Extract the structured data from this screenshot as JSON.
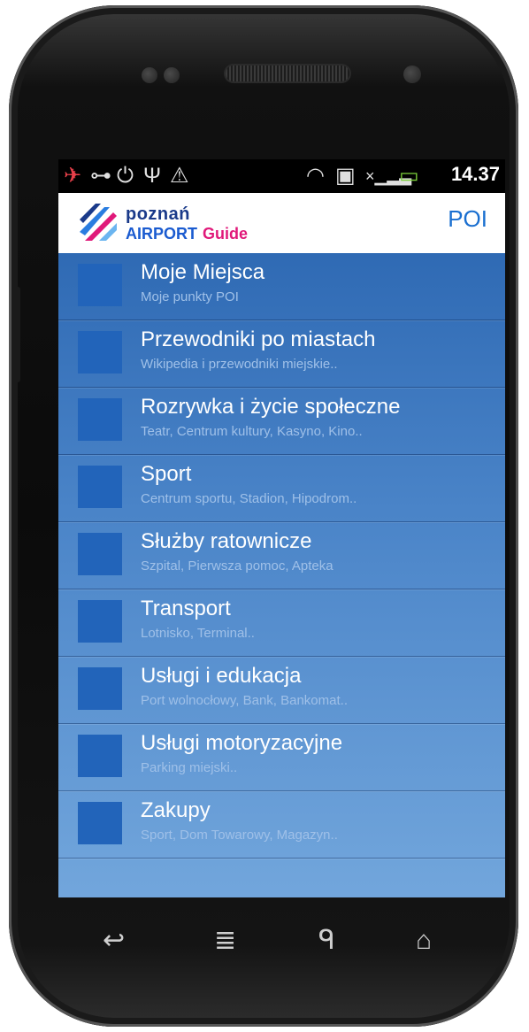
{
  "status_bar": {
    "time": "14.37"
  },
  "app_bar": {
    "logo_line1": "poznań",
    "logo_line2": "AIRPORT",
    "logo_line3": "Guide",
    "title": "POI"
  },
  "items": [
    {
      "title": "Moje Miejsca",
      "subtitle": "Moje punkty POI"
    },
    {
      "title": "Przewodniki po miastach",
      "subtitle": "Wikipedia i przewodniki miejskie.."
    },
    {
      "title": "Rozrywka i życie społeczne",
      "subtitle": "Teatr, Centrum kultury, Kasyno, Kino.."
    },
    {
      "title": "Sport",
      "subtitle": "Centrum sportu, Stadion, Hipodrom.."
    },
    {
      "title": "Służby ratownicze",
      "subtitle": "Szpital, Pierwsza pomoc, Apteka"
    },
    {
      "title": "Transport",
      "subtitle": "Lotnisko, Terminal.."
    },
    {
      "title": "Usługi i edukacja",
      "subtitle": "Port wolnocłowy, Bank, Bankomat.."
    },
    {
      "title": "Usługi motoryzacyjne",
      "subtitle": "Parking miejski.."
    },
    {
      "title": "Zakupy",
      "subtitle": "Sport, Dom Towarowy, Magazyn.."
    }
  ],
  "colors": {
    "list_top": "#2f6ab4",
    "list_bottom": "#72a6dc",
    "accent": "#1a6fd0",
    "brand_pink": "#e0197a"
  },
  "icons": [
    "airplane-icon",
    "link-icon",
    "power-icon",
    "usb-icon",
    "warning-icon",
    "wifi-icon",
    "sd-card-icon",
    "signal-icon",
    "battery-icon",
    "back-icon",
    "menu-icon",
    "search-icon",
    "home-icon"
  ]
}
